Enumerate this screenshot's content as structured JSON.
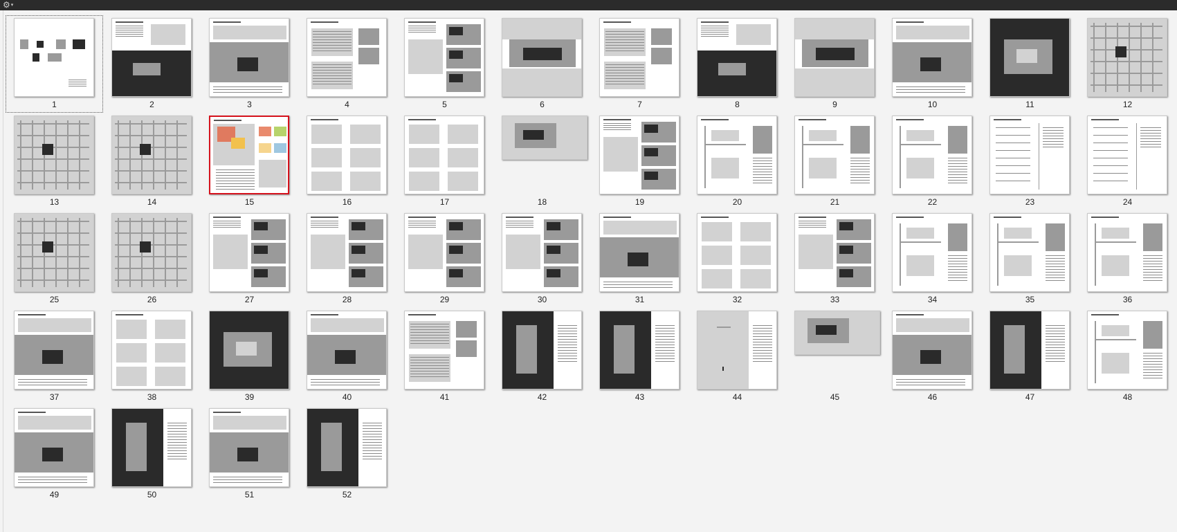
{
  "toolbar": {
    "menu_icon": "gear-icon",
    "menu_arrow": "▾"
  },
  "selected_page": "15",
  "pages": [
    {
      "n": "1",
      "t": "cover"
    },
    {
      "n": "2",
      "t": "dark-photo"
    },
    {
      "n": "3",
      "t": "photo-mid"
    },
    {
      "n": "4",
      "t": "plans"
    },
    {
      "n": "5",
      "t": "grid-photos"
    },
    {
      "n": "6",
      "t": "render"
    },
    {
      "n": "7",
      "t": "plans"
    },
    {
      "n": "8",
      "t": "dark-photo"
    },
    {
      "n": "9",
      "t": "render"
    },
    {
      "n": "10",
      "t": "photo-mid"
    },
    {
      "n": "11",
      "t": "black"
    },
    {
      "n": "12",
      "t": "map"
    },
    {
      "n": "13",
      "t": "map"
    },
    {
      "n": "14",
      "t": "map"
    },
    {
      "n": "15",
      "t": "colored"
    },
    {
      "n": "16",
      "t": "sketch"
    },
    {
      "n": "17",
      "t": "sketch"
    },
    {
      "n": "18",
      "t": "land"
    },
    {
      "n": "19",
      "t": "grid-photos"
    },
    {
      "n": "20",
      "t": "drawing"
    },
    {
      "n": "21",
      "t": "drawing"
    },
    {
      "n": "22",
      "t": "drawing"
    },
    {
      "n": "23",
      "t": "table"
    },
    {
      "n": "24",
      "t": "table"
    },
    {
      "n": "25",
      "t": "map"
    },
    {
      "n": "26",
      "t": "map"
    },
    {
      "n": "27",
      "t": "grid-photos"
    },
    {
      "n": "28",
      "t": "grid-photos"
    },
    {
      "n": "29",
      "t": "grid-photos"
    },
    {
      "n": "30",
      "t": "grid-photos"
    },
    {
      "n": "31",
      "t": "photo-mid"
    },
    {
      "n": "32",
      "t": "sketch"
    },
    {
      "n": "33",
      "t": "grid-photos"
    },
    {
      "n": "34",
      "t": "drawing"
    },
    {
      "n": "35",
      "t": "drawing"
    },
    {
      "n": "36",
      "t": "drawing"
    },
    {
      "n": "37",
      "t": "photo-mid"
    },
    {
      "n": "38",
      "t": "sketch"
    },
    {
      "n": "39",
      "t": "black"
    },
    {
      "n": "40",
      "t": "photo-mid"
    },
    {
      "n": "41",
      "t": "plans"
    },
    {
      "n": "42",
      "t": "dark-left"
    },
    {
      "n": "43",
      "t": "dark-left"
    },
    {
      "n": "44",
      "t": "grey-left"
    },
    {
      "n": "45",
      "t": "land"
    },
    {
      "n": "46",
      "t": "photo-mid"
    },
    {
      "n": "47",
      "t": "dark-left"
    },
    {
      "n": "48",
      "t": "drawing"
    },
    {
      "n": "49",
      "t": "photo-mid"
    },
    {
      "n": "50",
      "t": "dark-left"
    },
    {
      "n": "51",
      "t": "photo-mid"
    },
    {
      "n": "52",
      "t": "dark-left"
    }
  ]
}
